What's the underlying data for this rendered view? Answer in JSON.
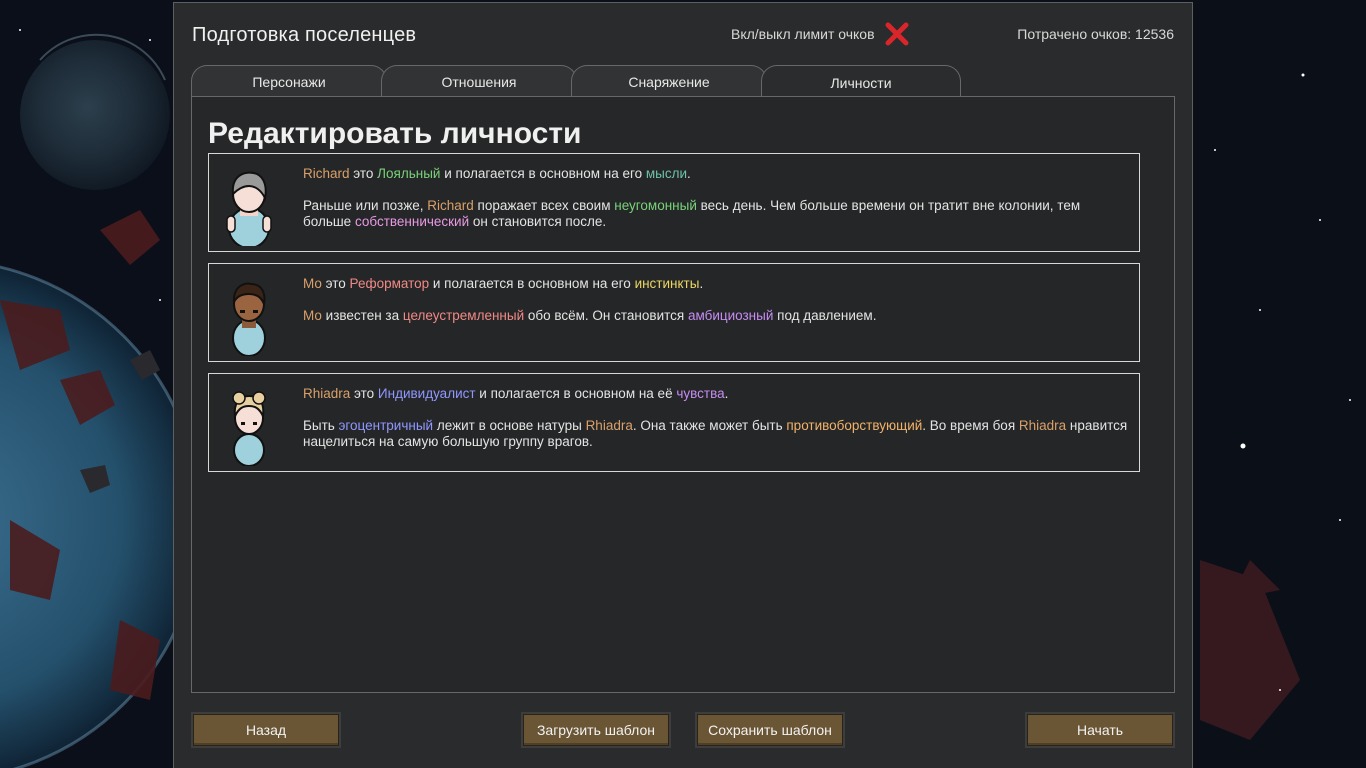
{
  "window": {
    "title": "Подготовка поселенцев",
    "limit_toggle_label": "Вкл/выкл лимит очков",
    "points_spent": "Потрачено очков: 12536"
  },
  "tabs": [
    {
      "label": "Персонажи",
      "active": false
    },
    {
      "label": "Отношения",
      "active": false
    },
    {
      "label": "Снаряжение",
      "active": false
    },
    {
      "label": "Личности",
      "active": true
    }
  ],
  "panel": {
    "heading": "Редактировать личности"
  },
  "personalities": [
    {
      "name": "Richard",
      "line1": [
        {
          "t": "Richard",
          "c": "name"
        },
        {
          "t": " это "
        },
        {
          "t": "Лояльный",
          "c": "green"
        },
        {
          "t": " и полагается в основном на его "
        },
        {
          "t": "мысли",
          "c": "teal"
        },
        {
          "t": "."
        }
      ],
      "line2": [
        {
          "t": "Раньше или позже, "
        },
        {
          "t": "Richard",
          "c": "name"
        },
        {
          "t": " поражает всех своим "
        },
        {
          "t": "неугомонный",
          "c": "green"
        },
        {
          "t": " весь день. Чем больше времени он тратит вне колонии, тем больше "
        },
        {
          "t": "собственнический",
          "c": "pink"
        },
        {
          "t": " он становится после."
        }
      ]
    },
    {
      "name": "Мо",
      "line1": [
        {
          "t": "Мо",
          "c": "name"
        },
        {
          "t": " это "
        },
        {
          "t": "Реформатор",
          "c": "red"
        },
        {
          "t": " и полагается в основном на его "
        },
        {
          "t": "инстинкты",
          "c": "yellow"
        },
        {
          "t": "."
        }
      ],
      "line2": [
        {
          "t": "Мо",
          "c": "name"
        },
        {
          "t": " известен за "
        },
        {
          "t": "целеустремленный",
          "c": "red"
        },
        {
          "t": " обо всём. Он становится "
        },
        {
          "t": "амбициозный",
          "c": "purple"
        },
        {
          "t": " под давлением."
        }
      ]
    },
    {
      "name": "Rhiadra",
      "line1": [
        {
          "t": "Rhiadra",
          "c": "name"
        },
        {
          "t": " это "
        },
        {
          "t": "Индивидуалист",
          "c": "blue"
        },
        {
          "t": " и полагается в основном на её "
        },
        {
          "t": "чувства",
          "c": "purple"
        },
        {
          "t": "."
        }
      ],
      "line2": [
        {
          "t": "Быть "
        },
        {
          "t": "эгоцентричный",
          "c": "blue"
        },
        {
          "t": " лежит в основе натуры "
        },
        {
          "t": "Rhiadra",
          "c": "name"
        },
        {
          "t": ". Она также может быть "
        },
        {
          "t": "противоборствующий",
          "c": "orange"
        },
        {
          "t": ". Во время боя "
        },
        {
          "t": "Rhiadra",
          "c": "name"
        },
        {
          "t": " нравится нацелиться на самую большую группу врагов."
        }
      ]
    }
  ],
  "buttons": {
    "back": "Назад",
    "load_template": "Загрузить шаблон",
    "save_template": "Сохранить шаблон",
    "start": "Начать"
  },
  "icons": {
    "limit_toggle": "red-x-icon"
  },
  "colors": {
    "dialog_bg": "#2a2b2c",
    "panel_bg": "#262728",
    "button_bg": "#6a5635",
    "toggle_off": "#d8262a"
  }
}
